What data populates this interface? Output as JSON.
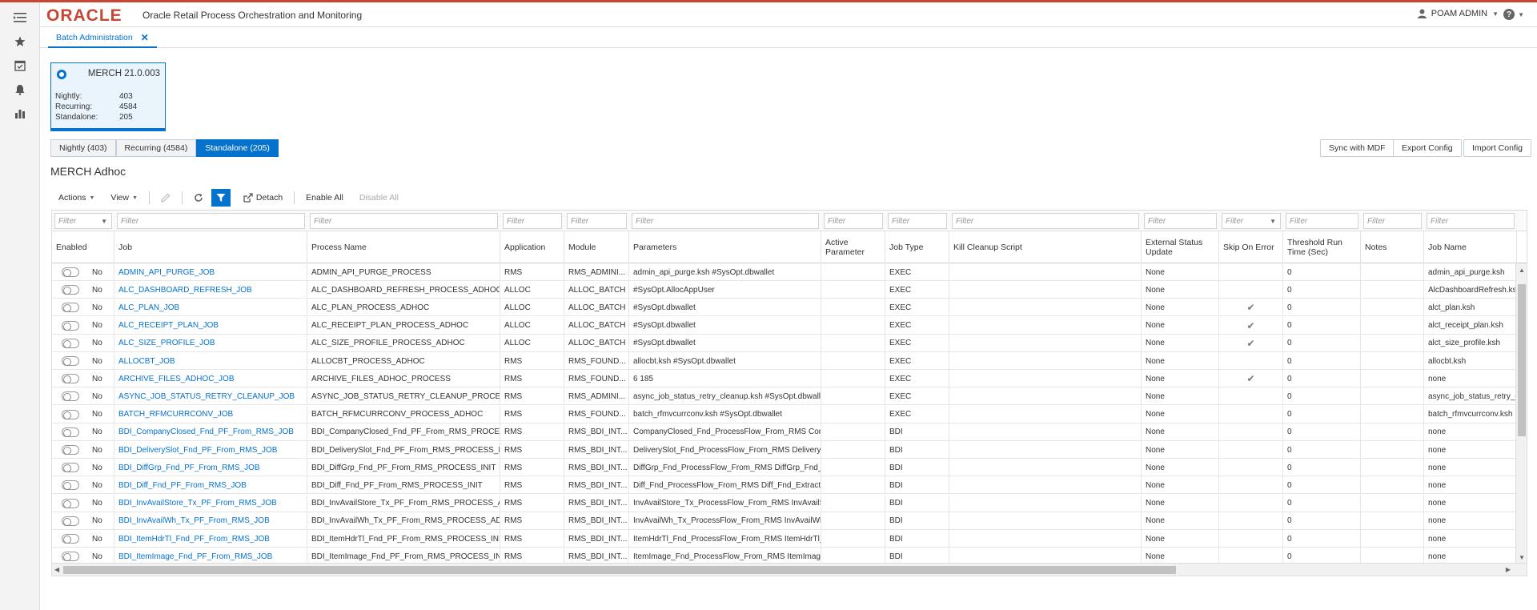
{
  "header": {
    "logo": "ORACLE",
    "app_title": "Oracle Retail Process Orchestration and Monitoring",
    "user": "POAM ADMIN",
    "help": "?"
  },
  "rail": {
    "icons": [
      "menu-icon",
      "star-icon",
      "checklist-icon",
      "bell-icon",
      "bar-chart-icon"
    ]
  },
  "tabs": [
    {
      "label": "Batch Administration",
      "close": "✕"
    }
  ],
  "card": {
    "title": "MERCH 21.0.003",
    "rows": [
      {
        "label": "Nightly:",
        "value": "403"
      },
      {
        "label": "Recurring:",
        "value": "4584"
      },
      {
        "label": "Standalone:",
        "value": "205"
      }
    ]
  },
  "segments": [
    "Nightly (403)",
    "Recurring (4584)",
    "Standalone (205)"
  ],
  "active_segment": 2,
  "buttons": {
    "sync": "Sync with MDF",
    "export": "Export Config",
    "import": "Import Config"
  },
  "section_title": "MERCH Adhoc",
  "toolbar": {
    "actions": "Actions",
    "view": "View",
    "detach": "Detach",
    "enable_all": "Enable All",
    "disable_all": "Disable All"
  },
  "filter_placeholder": "Filter",
  "columns": [
    "Enabled",
    "Job",
    "Process Name",
    "Application",
    "Module",
    "Parameters",
    "Active Parameter",
    "Job Type",
    "Kill Cleanup Script",
    "External Status Update",
    "Skip On Error",
    "Threshold Run Time (Sec)",
    "Notes",
    "Job Name"
  ],
  "rows": [
    {
      "enabled": "No",
      "job": "ADMIN_API_PURGE_JOB",
      "process": "ADMIN_API_PURGE_PROCESS",
      "app": "RMS",
      "module": "RMS_ADMINI...",
      "params": "admin_api_purge.ksh #SysOpt.dbwallet",
      "active": "",
      "type": "EXEC",
      "kill": "",
      "ext": "None",
      "skip": "",
      "threshold": "0",
      "notes": "",
      "jobname": "admin_api_purge.ksh"
    },
    {
      "enabled": "No",
      "job": "ALC_DASHBOARD_REFRESH_JOB",
      "process": "ALC_DASHBOARD_REFRESH_PROCESS_ADHOC",
      "app": "ALLOC",
      "module": "ALLOC_BATCH",
      "params": "#SysOpt.AllocAppUser",
      "active": "",
      "type": "EXEC",
      "kill": "",
      "ext": "None",
      "skip": "",
      "threshold": "0",
      "notes": "",
      "jobname": "AlcDashboardRefresh.ksh"
    },
    {
      "enabled": "No",
      "job": "ALC_PLAN_JOB",
      "process": "ALC_PLAN_PROCESS_ADHOC",
      "app": "ALLOC",
      "module": "ALLOC_BATCH",
      "params": "#SysOpt.dbwallet",
      "active": "",
      "type": "EXEC",
      "kill": "",
      "ext": "None",
      "skip": "✔",
      "threshold": "0",
      "notes": "",
      "jobname": "alct_plan.ksh"
    },
    {
      "enabled": "No",
      "job": "ALC_RECEIPT_PLAN_JOB",
      "process": "ALC_RECEIPT_PLAN_PROCESS_ADHOC",
      "app": "ALLOC",
      "module": "ALLOC_BATCH",
      "params": "#SysOpt.dbwallet",
      "active": "",
      "type": "EXEC",
      "kill": "",
      "ext": "None",
      "skip": "✔",
      "threshold": "0",
      "notes": "",
      "jobname": "alct_receipt_plan.ksh"
    },
    {
      "enabled": "No",
      "job": "ALC_SIZE_PROFILE_JOB",
      "process": "ALC_SIZE_PROFILE_PROCESS_ADHOC",
      "app": "ALLOC",
      "module": "ALLOC_BATCH",
      "params": "#SysOpt.dbwallet",
      "active": "",
      "type": "EXEC",
      "kill": "",
      "ext": "None",
      "skip": "✔",
      "threshold": "0",
      "notes": "",
      "jobname": "alct_size_profile.ksh"
    },
    {
      "enabled": "No",
      "job": "ALLOCBT_JOB",
      "process": "ALLOCBT_PROCESS_ADHOC",
      "app": "RMS",
      "module": "RMS_FOUND...",
      "params": "allocbt.ksh #SysOpt.dbwallet",
      "active": "",
      "type": "EXEC",
      "kill": "",
      "ext": "None",
      "skip": "",
      "threshold": "0",
      "notes": "",
      "jobname": "allocbt.ksh"
    },
    {
      "enabled": "No",
      "job": "ARCHIVE_FILES_ADHOC_JOB",
      "process": "ARCHIVE_FILES_ADHOC_PROCESS",
      "app": "RMS",
      "module": "RMS_FOUND...",
      "params": "6 185",
      "active": "",
      "type": "EXEC",
      "kill": "",
      "ext": "None",
      "skip": "✔",
      "threshold": "0",
      "notes": "",
      "jobname": "none"
    },
    {
      "enabled": "No",
      "job": "ASYNC_JOB_STATUS_RETRY_CLEANUP_JOB",
      "process": "ASYNC_JOB_STATUS_RETRY_CLEANUP_PROCESS_A...",
      "app": "RMS",
      "module": "RMS_ADMINI...",
      "params": "async_job_status_retry_cleanup.ksh #SysOpt.dbwallet",
      "active": "",
      "type": "EXEC",
      "kill": "",
      "ext": "None",
      "skip": "",
      "threshold": "0",
      "notes": "",
      "jobname": "async_job_status_retry_cle"
    },
    {
      "enabled": "No",
      "job": "BATCH_RFMCURRCONV_JOB",
      "process": "BATCH_RFMCURRCONV_PROCESS_ADHOC",
      "app": "RMS",
      "module": "RMS_FOUND...",
      "params": "batch_rfmvcurrconv.ksh #SysOpt.dbwallet",
      "active": "",
      "type": "EXEC",
      "kill": "",
      "ext": "None",
      "skip": "",
      "threshold": "0",
      "notes": "",
      "jobname": "batch_rfmvcurrconv.ksh"
    },
    {
      "enabled": "No",
      "job": "BDI_CompanyClosed_Fnd_PF_From_RMS_JOB",
      "process": "BDI_CompanyClosed_Fnd_PF_From_RMS_PROCESS...",
      "app": "RMS",
      "module": "RMS_BDI_INT...",
      "params": "CompanyClosed_Fnd_ProcessFlow_From_RMS Com...",
      "active": "",
      "type": "BDI",
      "kill": "",
      "ext": "None",
      "skip": "",
      "threshold": "0",
      "notes": "",
      "jobname": "none"
    },
    {
      "enabled": "No",
      "job": "BDI_DeliverySlot_Fnd_PF_From_RMS_JOB",
      "process": "BDI_DeliverySlot_Fnd_PF_From_RMS_PROCESS_INIT",
      "app": "RMS",
      "module": "RMS_BDI_INT...",
      "params": "DeliverySlot_Fnd_ProcessFlow_From_RMS DeliveryS...",
      "active": "",
      "type": "BDI",
      "kill": "",
      "ext": "None",
      "skip": "",
      "threshold": "0",
      "notes": "",
      "jobname": "none"
    },
    {
      "enabled": "No",
      "job": "BDI_DiffGrp_Fnd_PF_From_RMS_JOB",
      "process": "BDI_DiffGrp_Fnd_PF_From_RMS_PROCESS_INIT",
      "app": "RMS",
      "module": "RMS_BDI_INT...",
      "params": "DiffGrp_Fnd_ProcessFlow_From_RMS DiffGrp_Fnd_E...",
      "active": "",
      "type": "BDI",
      "kill": "",
      "ext": "None",
      "skip": "",
      "threshold": "0",
      "notes": "",
      "jobname": "none"
    },
    {
      "enabled": "No",
      "job": "BDI_Diff_Fnd_PF_From_RMS_JOB",
      "process": "BDI_Diff_Fnd_PF_From_RMS_PROCESS_INIT",
      "app": "RMS",
      "module": "RMS_BDI_INT...",
      "params": "Diff_Fnd_ProcessFlow_From_RMS Diff_Fnd_Extractor",
      "active": "",
      "type": "BDI",
      "kill": "",
      "ext": "None",
      "skip": "",
      "threshold": "0",
      "notes": "",
      "jobname": "none"
    },
    {
      "enabled": "No",
      "job": "BDI_InvAvailStore_Tx_PF_From_RMS_JOB",
      "process": "BDI_InvAvailStore_Tx_PF_From_RMS_PROCESS_ADH...",
      "app": "RMS",
      "module": "RMS_BDI_INT...",
      "params": "InvAvailStore_Tx_ProcessFlow_From_RMS InvAvailSt...",
      "active": "",
      "type": "BDI",
      "kill": "",
      "ext": "None",
      "skip": "",
      "threshold": "0",
      "notes": "",
      "jobname": "none"
    },
    {
      "enabled": "No",
      "job": "BDI_InvAvailWh_Tx_PF_From_RMS_JOB",
      "process": "BDI_InvAvailWh_Tx_PF_From_RMS_PROCESS_ADHOC",
      "app": "RMS",
      "module": "RMS_BDI_INT...",
      "params": "InvAvailWh_Tx_ProcessFlow_From_RMS InvAvailWh...",
      "active": "",
      "type": "BDI",
      "kill": "",
      "ext": "None",
      "skip": "",
      "threshold": "0",
      "notes": "",
      "jobname": "none"
    },
    {
      "enabled": "No",
      "job": "BDI_ItemHdrTl_Fnd_PF_From_RMS_JOB",
      "process": "BDI_ItemHdrTl_Fnd_PF_From_RMS_PROCESS_INIT",
      "app": "RMS",
      "module": "RMS_BDI_INT...",
      "params": "ItemHdrTl_Fnd_ProcessFlow_From_RMS ItemHdrTl_...",
      "active": "",
      "type": "BDI",
      "kill": "",
      "ext": "None",
      "skip": "",
      "threshold": "0",
      "notes": "",
      "jobname": "none"
    },
    {
      "enabled": "No",
      "job": "BDI_ItemImage_Fnd_PF_From_RMS_JOB",
      "process": "BDI_ItemImage_Fnd_PF_From_RMS_PROCESS_INIT",
      "app": "RMS",
      "module": "RMS_BDI_INT...",
      "params": "ItemImage_Fnd_ProcessFlow_From_RMS ItemImag...",
      "active": "",
      "type": "BDI",
      "kill": "",
      "ext": "None",
      "skip": "",
      "threshold": "0",
      "notes": "",
      "jobname": "none"
    }
  ]
}
